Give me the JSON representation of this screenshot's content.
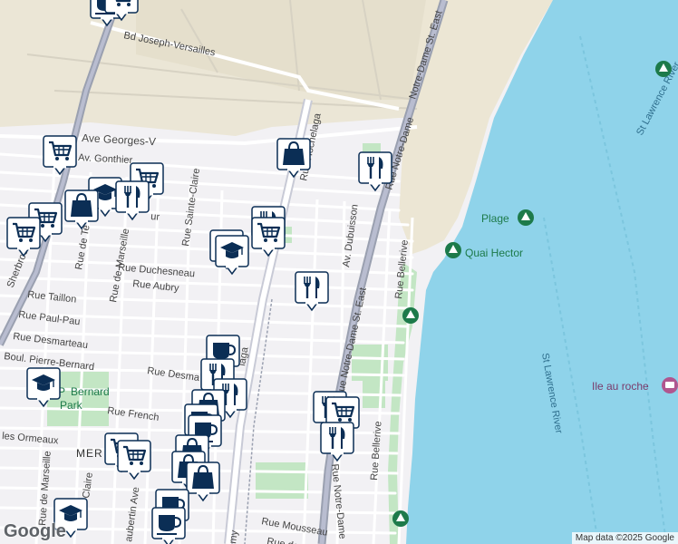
{
  "streets": {
    "joseph_versailles": "Bd Joseph-Versailles",
    "georges_v": "Ave Georges-V",
    "gonthier": "Av. Gonthier",
    "hochelaga_n": "Rue Hochelaga",
    "hochelaga_s": "Hochelaga",
    "notre_dame_st_east_n": "Notre-Dame St. East",
    "notre_dame_n": "Rue Notre-Dame",
    "notre_dame_st_east_mid": "Rue Notre-Dame St. East",
    "notre_dame_s": "Rue Notre-Dame",
    "sainte_claire": "Rue Sainte-Claire",
    "dubuisson": "Av. Dubuisson",
    "bellerive_n": "Rue Bellerive",
    "bellerive_s": "Rue Bellerive",
    "duchesneau": "Rue Duchesneau",
    "aubry": "Rue Aubry",
    "taillon": "Rue Taillon",
    "paul_pau": "Rue Paul-Pau",
    "desmarteau": "Rue Desmarteau",
    "pierre_bernard": "Boul. Pierre-Bernard",
    "desmarteau_s": "Rue Desma",
    "french": "Rue French",
    "ormeaux": "les Ormeaux",
    "marseille_n": "rue de Marseille",
    "marseille_mid": "Rue de Marseille",
    "marseille_s": "Rue de Marseille",
    "sherbrooke": "Sherbroo",
    "aubertin": "aubertin Ave",
    "claire": "Claire",
    "mousseau": "Rue Mousseau",
    "de_partial": "Rue de",
    "te_partial": "Rue de Te",
    "ur_partial": "ur",
    "laga": "laga",
    "my": "my"
  },
  "water": {
    "st_lawrence_n": "St Lawrence River",
    "st_lawrence_s": "St Lawrence River"
  },
  "pois": {
    "plage": "Plage",
    "quai_hector": "Quai Hector",
    "ile_au_roche": "Ile au roche",
    "park": "P   Bernard\nPark"
  },
  "neighborhood": "MER    T",
  "park_line1": "P",
  "park_bernard": "Bernard",
  "park_line2": "Park",
  "colors": {
    "water": "#8fd3ea",
    "beach": "#ece6d4",
    "industrial": "#e8e3d3",
    "park": "#c3e6c4",
    "marker_blue": "#0b2e55",
    "road": "#ffffff",
    "highway": "#9aa0b0"
  },
  "markers": [
    {
      "icon": "coffee-icon",
      "label": "coffee"
    },
    {
      "icon": "shopping-cart-icon",
      "label": "grocery"
    },
    {
      "icon": "shopping-bag-icon",
      "label": "shopping"
    },
    {
      "icon": "restaurant-icon",
      "label": "restaurant"
    },
    {
      "icon": "school-icon",
      "label": "school"
    }
  ],
  "attribution": "Map data ©2025 Google",
  "logo": "Google"
}
